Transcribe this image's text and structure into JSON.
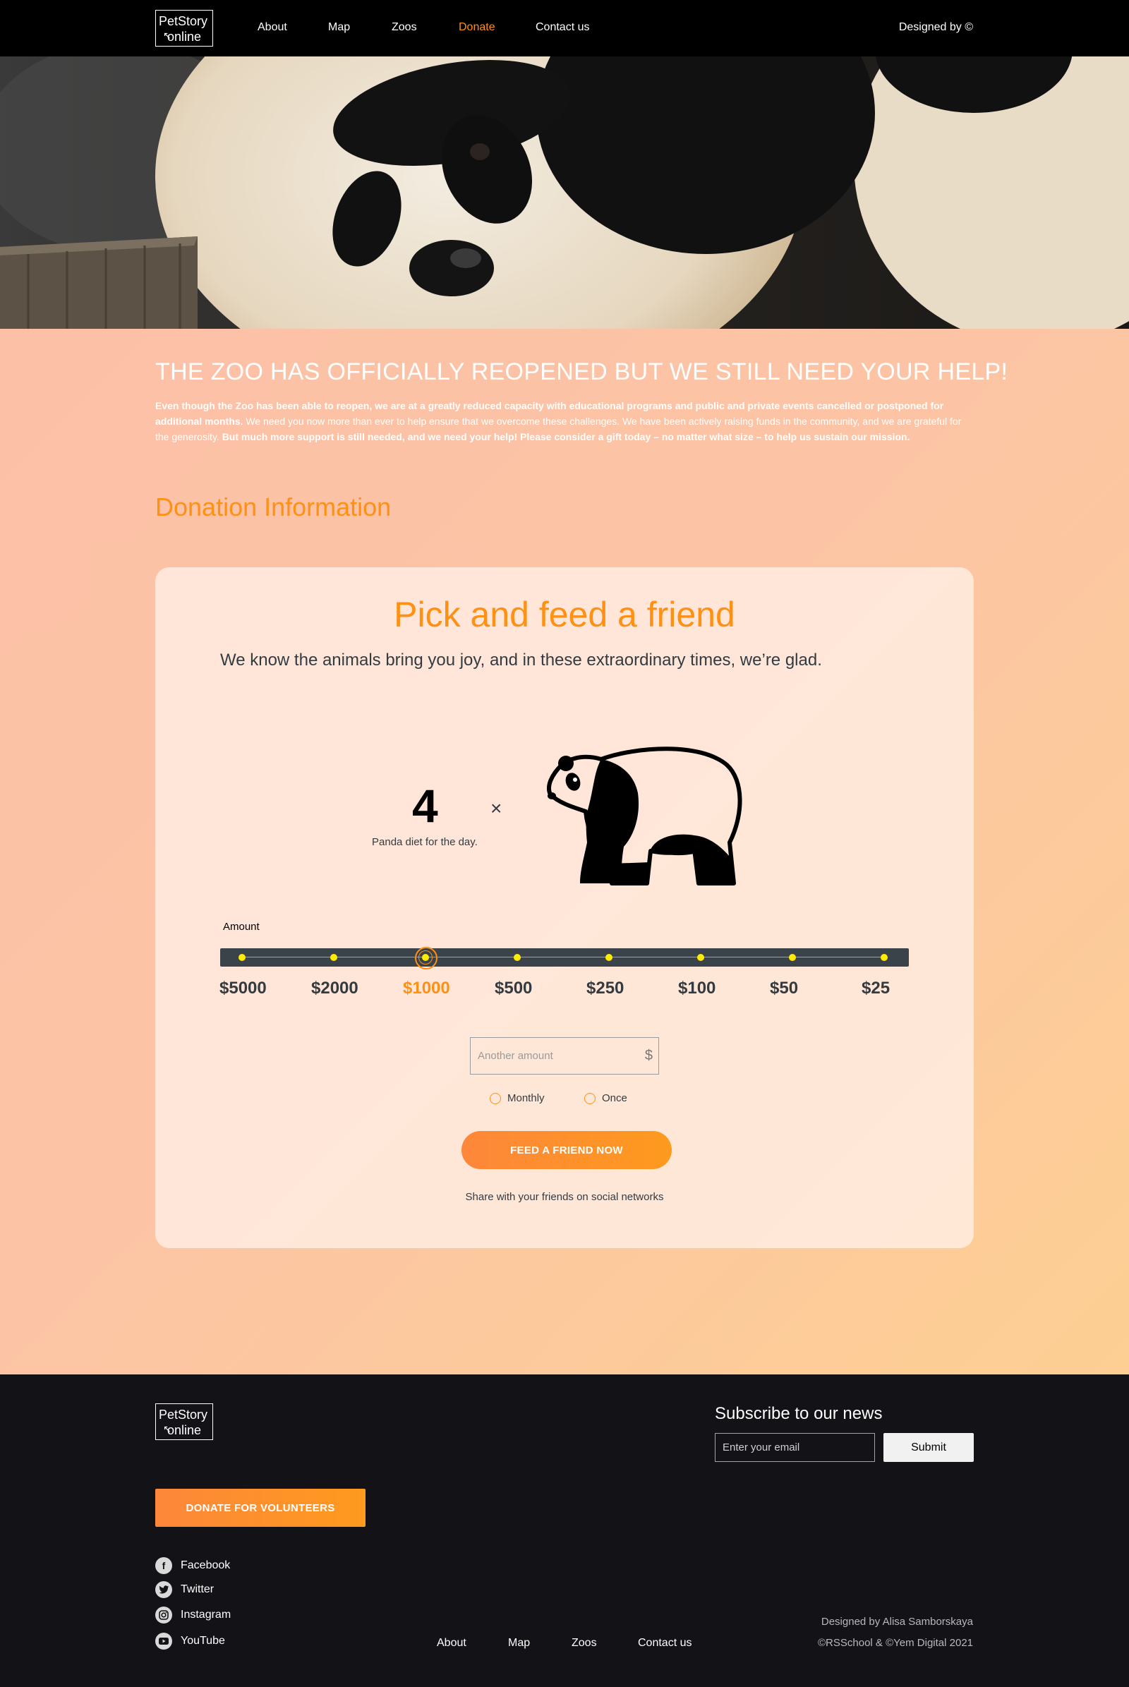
{
  "header": {
    "logo": {
      "line1": "PetStory",
      "line2": "online"
    },
    "nav": [
      "About",
      "Map",
      "Zoos",
      "Donate",
      "Contact us"
    ],
    "active_nav": "Donate",
    "designed_by": "Designed by ©"
  },
  "intro": {
    "title": "THE ZOO HAS OFFICIALLY REOPENED BUT WE STILL NEED YOUR HELP!",
    "text_bold1": "Even though the Zoo has been able to reopen, we are at a greatly reduced capacity with educational programs and public and private events cancelled or postponed for additional months.",
    "text_regular": " We need you now more than ever to help ensure that we overcome these challenges. We have been actively raising funds in the community, and we are grateful for the generosity. ",
    "text_bold2": " But much more support is still needed, and we need your help! Please consider a gift today – no matter what size – to help us sustain our mission."
  },
  "donation_heading": "Donation Information",
  "card": {
    "title": "Pick and feed a friend",
    "subtitle": "We know the animals bring you joy, and in these extraordinary times, we’re glad.",
    "count": "4",
    "count_label": "Panda diet for the day.",
    "times_sign": "×",
    "amount_label": "Amount",
    "amounts": [
      "$5000",
      "$2000",
      "$1000",
      "$500",
      "$250",
      "$100",
      "$50",
      "$25"
    ],
    "selected_amount": "$1000",
    "another_placeholder": "Another amount",
    "currency_sign": "$",
    "frequency_options": [
      "Monthly",
      "Once"
    ],
    "feed_button": "FEED A FRIEND NOW",
    "share_text": "Share with your friends on social networks"
  },
  "footer": {
    "logo": {
      "line1": "PetStory",
      "line2": "online"
    },
    "subscribe_title": "Subscribe to our news",
    "email_placeholder": "Enter your email",
    "submit_label": "Submit",
    "donate_button": "DONATE FOR VOLUNTEERS",
    "social": [
      {
        "label": "Facebook",
        "icon": "facebook-icon"
      },
      {
        "label": "Twitter",
        "icon": "twitter-icon"
      },
      {
        "label": "Instagram",
        "icon": "instagram-icon"
      },
      {
        "label": "YouTube",
        "icon": "youtube-icon"
      }
    ],
    "nav": [
      "About",
      "Map",
      "Zoos",
      "Contact us"
    ],
    "credit1": "Designed by Alisa Samborskaya",
    "credit2": "©RSSchool & ©Yem Digital 2021"
  },
  "colors": {
    "accent": "#fe9013",
    "dark": "#121217",
    "track": "#3b434a",
    "dot": "#ffec00"
  }
}
